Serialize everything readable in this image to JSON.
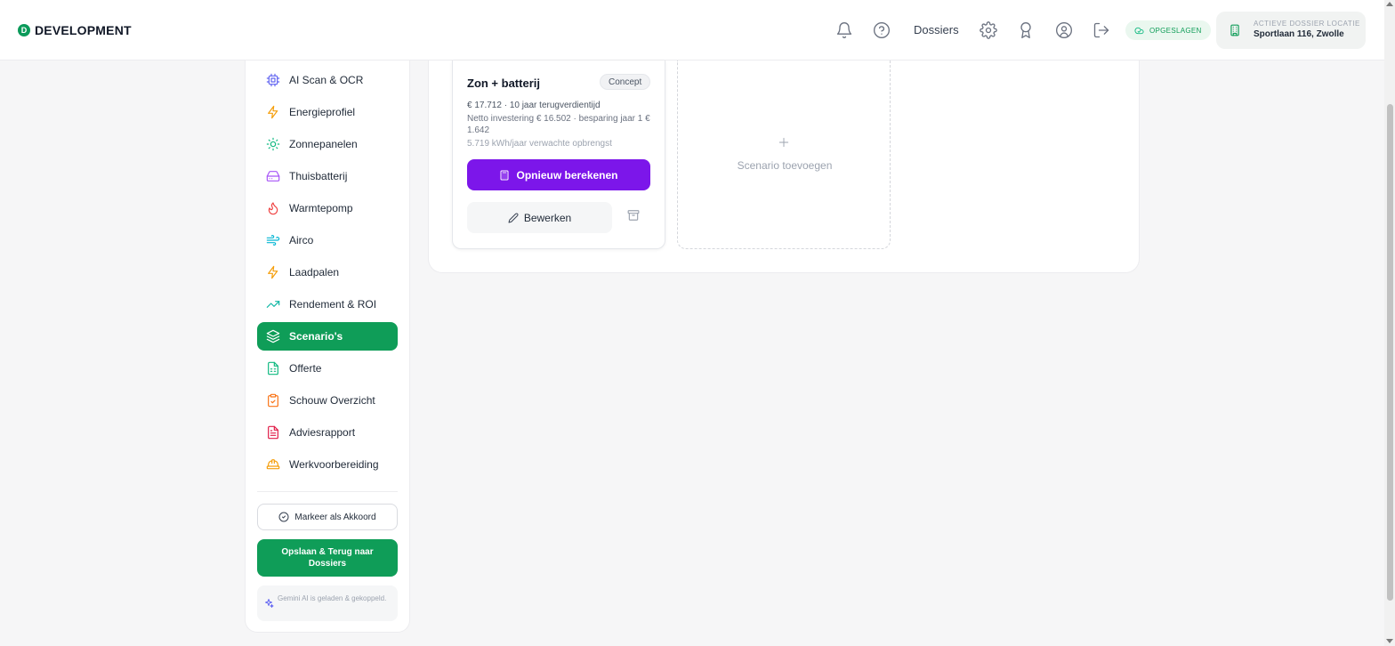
{
  "header": {
    "brand_letter": "D",
    "brand_name": "DEVELOPMENT",
    "nav_dossiers": "Dossiers",
    "saved_status": "OPGESLAGEN",
    "location_label": "ACTIEVE DOSSIER LOCATIE",
    "location_value": "Sportlaan 116, Zwolle",
    "icons": [
      "bell-icon",
      "help-icon",
      "gear-icon",
      "award-icon",
      "user-circle-icon",
      "logout-icon",
      "cloud-check-icon",
      "building-icon"
    ]
  },
  "sidebar": {
    "items": [
      {
        "label": "AI Scan & OCR",
        "icon": "cpu-icon",
        "color": "#6366f1"
      },
      {
        "label": "Energieprofiel",
        "icon": "bolt-icon",
        "color": "#f59e0b"
      },
      {
        "label": "Zonnepanelen",
        "icon": "sun-icon",
        "color": "#10b981"
      },
      {
        "label": "Thuisbatterij",
        "icon": "hard-drive-icon",
        "color": "#a855f7"
      },
      {
        "label": "Warmtepomp",
        "icon": "flame-icon",
        "color": "#ef4444"
      },
      {
        "label": "Airco",
        "icon": "wind-icon",
        "color": "#06b6d4"
      },
      {
        "label": "Laadpalen",
        "icon": "bolt-icon",
        "color": "#f59e0b"
      },
      {
        "label": "Rendement & ROI",
        "icon": "trending-up-icon",
        "color": "#14b8a6"
      },
      {
        "label": "Scenario's",
        "icon": "layers-icon",
        "color": "#ffffff",
        "active": true
      },
      {
        "label": "Offerte",
        "icon": "sheet-icon",
        "color": "#10b981"
      },
      {
        "label": "Schouw Overzicht",
        "icon": "clipboard-check-icon",
        "color": "#f97316"
      },
      {
        "label": "Adviesrapport",
        "icon": "file-text-icon",
        "color": "#e11d48"
      },
      {
        "label": "Werkvoorbereiding",
        "icon": "hard-hat-icon",
        "color": "#f59e0b"
      }
    ],
    "mark_accorded_label": "Markeer als Akkoord",
    "save_back_label": "Opslaan & Terug naar Dossiers",
    "gemini_status": "Gemini AI is geladen & gekoppeld."
  },
  "main": {
    "scenario": {
      "title": "Zon + batterij",
      "status_badge": "Concept",
      "summary": "€ 17.712 · 10 jaar terugverdientijd",
      "investment": "Netto investering € 16.502 · besparing jaar 1 € 1.642",
      "yield": "5.719 kWh/jaar verwachte opbrengst",
      "recalculate_label": "Opnieuw berekenen",
      "edit_label": "Bewerken"
    },
    "add_scenario_label": "Scenario toevoegen"
  },
  "colors": {
    "primary_green": "#0f9d58",
    "accent_purple": "#7c16ea"
  }
}
